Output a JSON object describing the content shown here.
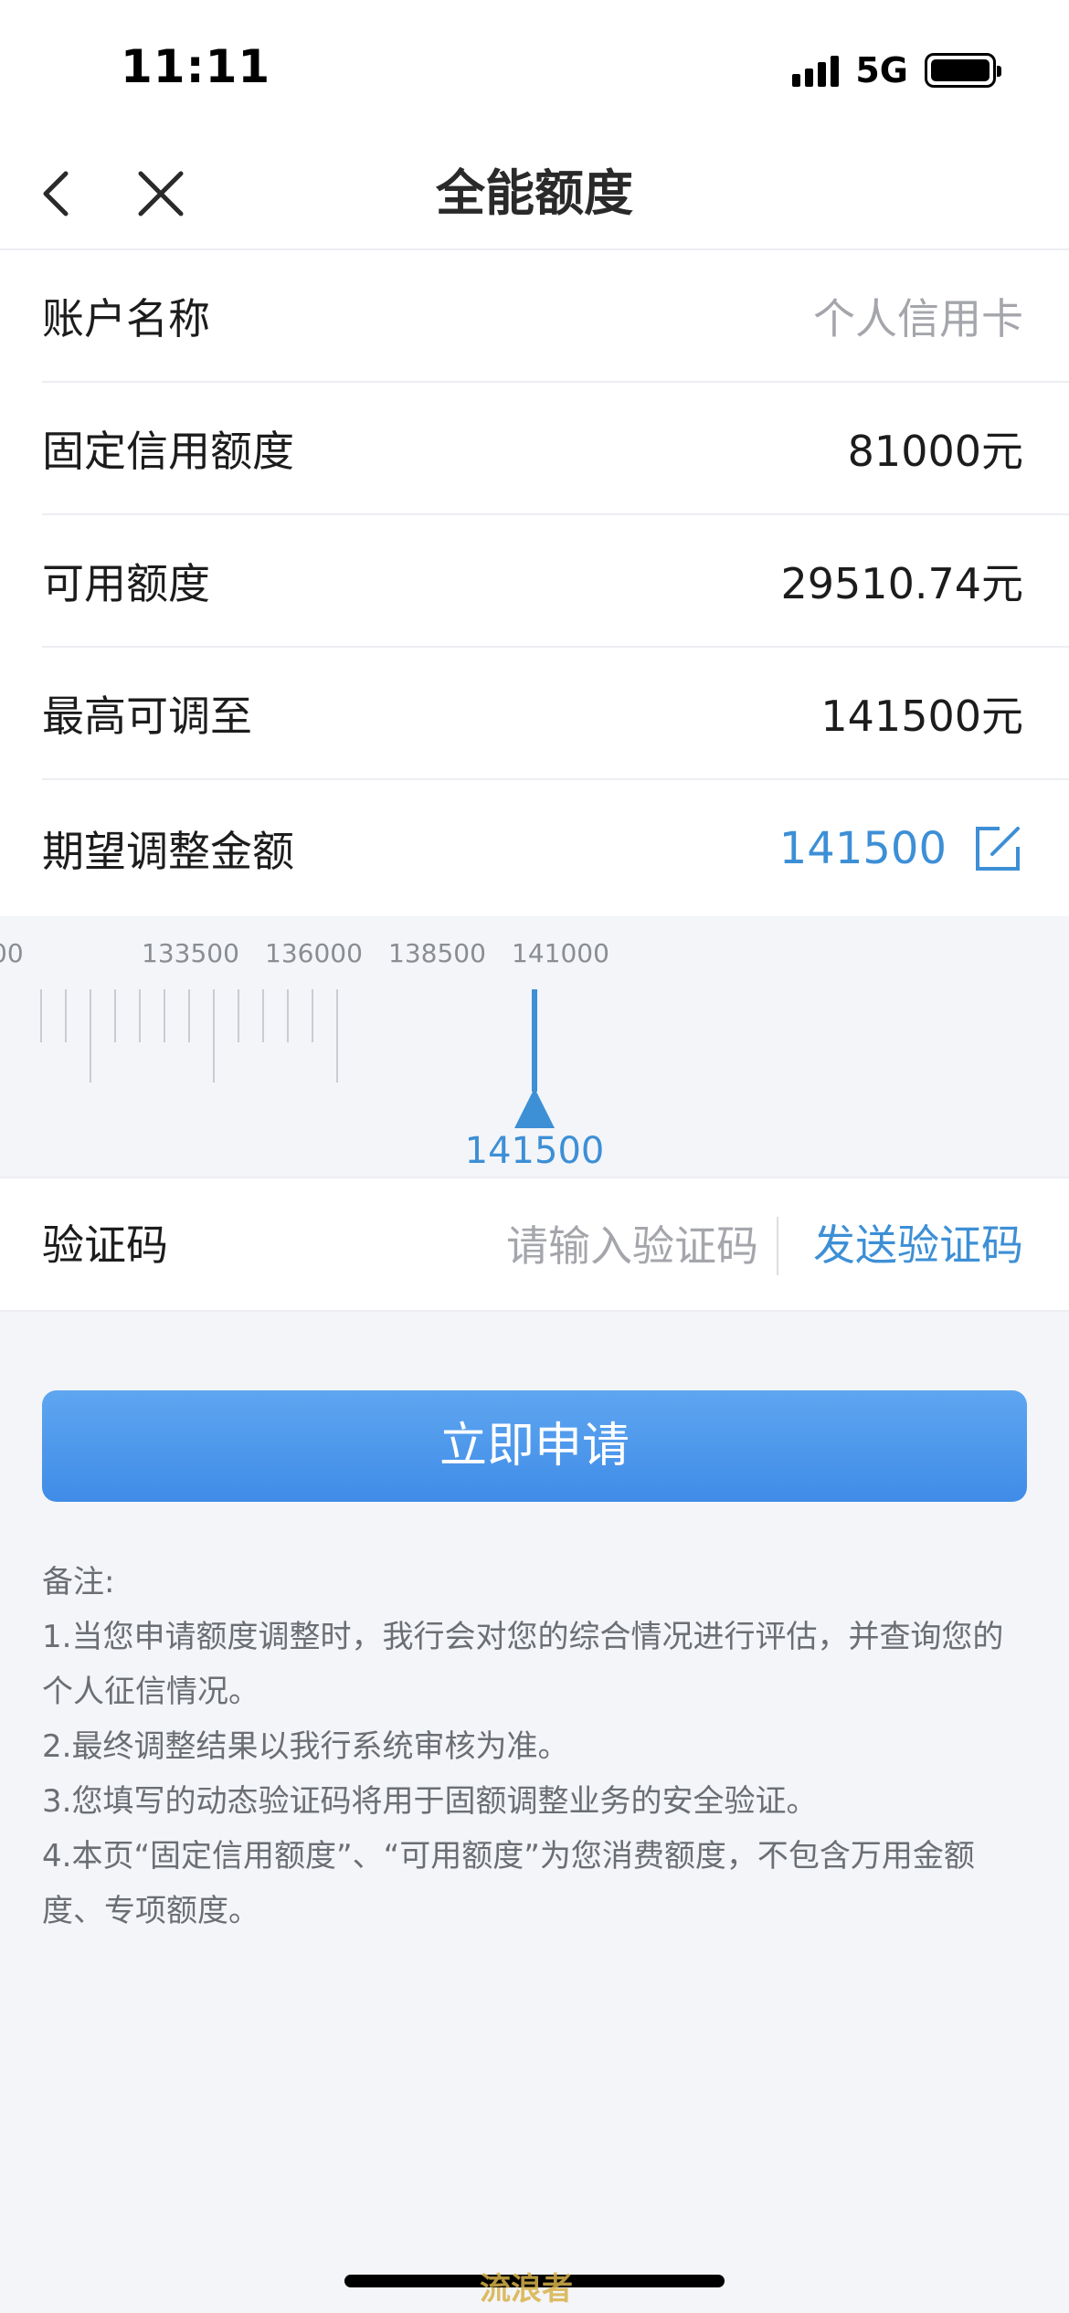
{
  "status_bar": {
    "time": "11:11",
    "network": "5G",
    "icons": [
      "signal-icon",
      "battery-icon"
    ]
  },
  "nav": {
    "title": "全能额度",
    "back_icon": "chevron-left-icon",
    "close_icon": "close-icon"
  },
  "account": {
    "rows": [
      {
        "label": "账户名称",
        "value": "个人信用卡"
      },
      {
        "label": "固定信用额度",
        "value": "81000元"
      },
      {
        "label": "可用额度",
        "value": "29510.74元"
      },
      {
        "label": "最高可调至",
        "value": "141500元"
      }
    ],
    "expected": {
      "label": "期望调整金额",
      "value": "141500",
      "edit_icon": "edit-icon"
    }
  },
  "ruler": {
    "tick_labels": [
      "00",
      "133500",
      "136000",
      "138500",
      "141000"
    ],
    "selected_label": "141500",
    "selected_value": 141500,
    "accent_color": "#3d8fd6"
  },
  "verification": {
    "label": "验证码",
    "placeholder": "请输入验证码",
    "value": "",
    "send_label": "发送验证码"
  },
  "apply": {
    "label": "立即申请"
  },
  "notes": {
    "title": "备注:",
    "items": [
      "1.当您申请额度调整时，我行会对您的综合情况进行评估，并查询您的个人征信情况。",
      "2.最终调整结果以我行系统审核为准。",
      "3.您填写的动态验证码将用于固额调整业务的安全验证。",
      "4.本页“固定信用额度”、“可用额度”为您消费额度，不包含万用金额度、专项额度。"
    ]
  },
  "watermark": "流浪者",
  "colors": {
    "accent": "#3d8fd6",
    "button": "#4a95eb",
    "background": "#f3f5f9"
  }
}
